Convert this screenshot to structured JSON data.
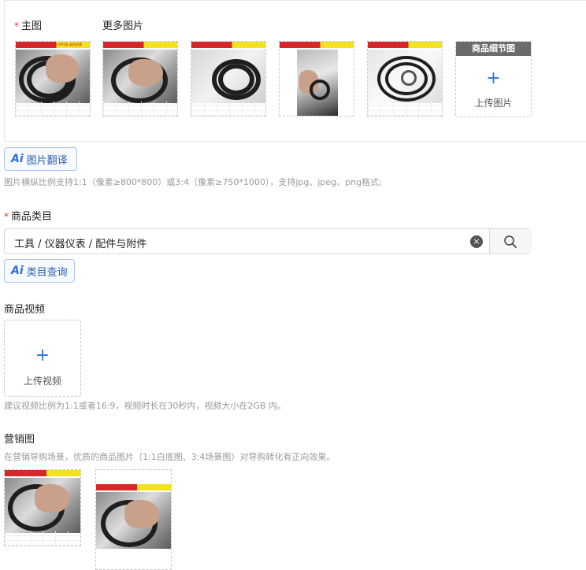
{
  "main_image": {
    "required_mark": "*",
    "label": "主图"
  },
  "more_images": {
    "label": "更多图片"
  },
  "detail_image": {
    "header": "商品细节图",
    "plus": "+",
    "upload_label": "上传图片"
  },
  "ai_translate": {
    "logo": "Ai",
    "label": "图片翻译"
  },
  "image_hint": "图片横纵比例支持1:1（像素≥800*800）或3:4（像素≥750*1000），支持jpg、jpeg、png格式;",
  "category": {
    "required_mark": "*",
    "label": "商品类目",
    "value": "工具 / 仪器仪表 / 配件与附件",
    "clear_icon": "×",
    "search_icon": "search-icon"
  },
  "ai_category": {
    "logo": "Ai",
    "label": "类目查询"
  },
  "video": {
    "label": "商品视频",
    "plus": "+",
    "upload_label": "上传视频",
    "hint": "建议视频比例为1:1或者16:9，视频时长在30秒内，视频大小在2GB 内。"
  },
  "marketing": {
    "label": "营销图",
    "hint": "在营销导购场景，优质的商品图片（1:1白底图、3:4场景图）对导购转化有正向效果。"
  },
  "thumb_banner_text": "一件代发 诚信经营"
}
